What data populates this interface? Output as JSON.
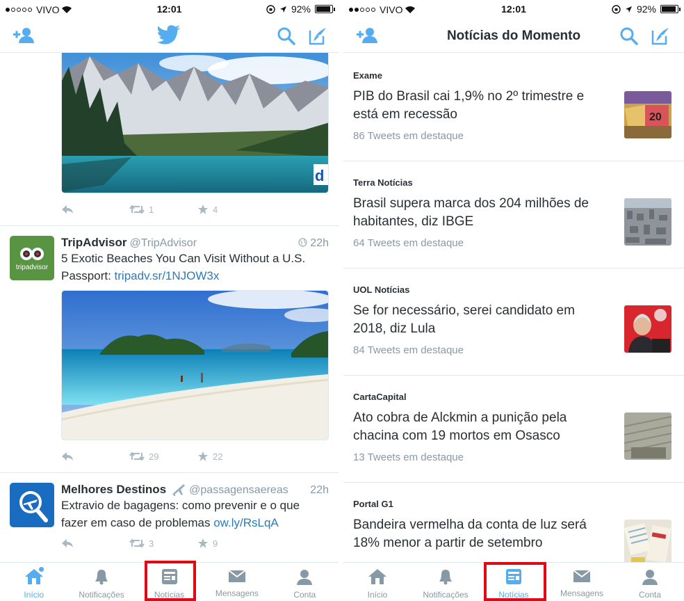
{
  "left": {
    "status": {
      "carrier": "VIVO",
      "time": "12:01",
      "battery": "92%"
    },
    "tweets": [
      {
        "retweets": "1",
        "favorites": "4"
      },
      {
        "name": "TripAdvisor",
        "handle": "@TripAdvisor",
        "time": "22h",
        "text": "5 Exotic Beaches You Can Visit Without a U.S. Passport: ",
        "link": "tripadv.sr/1NJOW3x",
        "avatar_text": "tripadvisor",
        "retweets": "29",
        "favorites": "22"
      },
      {
        "name": "Melhores Destinos",
        "handle": "@passagensaereas",
        "time": "22h",
        "text": "Extravio de bagagens: como prevenir e o que fazer em caso de problemas ",
        "link": "ow.ly/RsLqA",
        "retweets": "3",
        "favorites": "9"
      }
    ],
    "tabs": [
      {
        "label": "Início",
        "icon": "home-icon"
      },
      {
        "label": "Notificações",
        "icon": "bell-icon"
      },
      {
        "label": "Notícias",
        "icon": "news-icon"
      },
      {
        "label": "Mensagens",
        "icon": "envelope-icon"
      },
      {
        "label": "Conta",
        "icon": "person-icon"
      }
    ]
  },
  "right": {
    "status": {
      "carrier": "VIVO",
      "time": "12:01",
      "battery": "92%"
    },
    "title": "Notícias do Momento",
    "news": [
      {
        "source": "Exame",
        "headline": "PIB do Brasil cai 1,9% no 2º trimestre e está em recessão",
        "count": "86 Tweets em destaque"
      },
      {
        "source": "Terra Notícias",
        "headline": "Brasil supera marca dos 204 milhões de habitantes, diz IBGE",
        "count": "64 Tweets em destaque"
      },
      {
        "source": "UOL Notícias",
        "headline": "Se for necessário, serei candidato em 2018, diz Lula",
        "count": "84 Tweets em destaque"
      },
      {
        "source": "CartaCapital",
        "headline": "Ato cobra de Alckmin a punição pela chacina com 19 mortos em Osasco",
        "count": "13 Tweets em destaque"
      },
      {
        "source": "Portal G1",
        "headline": "Bandeira vermelha da conta de luz será 18% menor a partir de setembro",
        "count": ""
      }
    ],
    "tabs": [
      {
        "label": "Início",
        "icon": "home-icon"
      },
      {
        "label": "Notificações",
        "icon": "bell-icon"
      },
      {
        "label": "Notícias",
        "icon": "news-icon"
      },
      {
        "label": "Mensagens",
        "icon": "envelope-icon"
      },
      {
        "label": "Conta",
        "icon": "person-icon"
      }
    ]
  },
  "colors": {
    "accent": "#55acee",
    "highlight": "#e30613",
    "link": "#2b7bb9",
    "muted": "#8899a6"
  }
}
